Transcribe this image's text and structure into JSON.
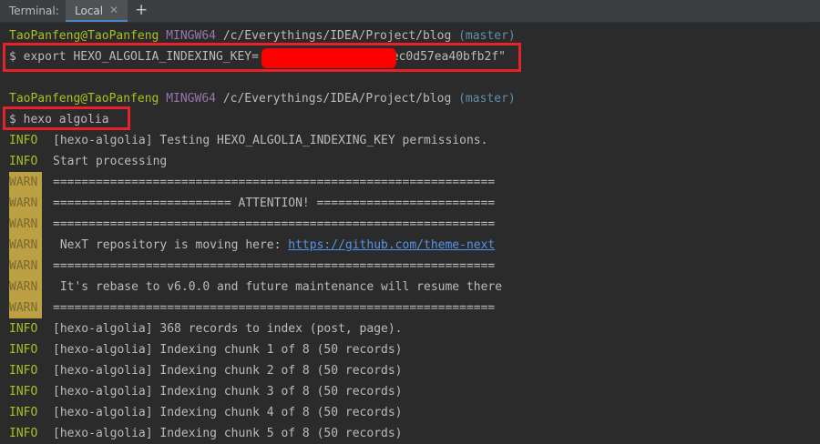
{
  "tabbar": {
    "label": "Terminal:",
    "tab": "Local",
    "close": "✕",
    "add": "+"
  },
  "prompt1": {
    "user": "TaoPanfeng@TaoPanfeng",
    "shell": "MINGW64",
    "path": "/c/Everythings/IDEA/Project/blog",
    "branch": "(master)"
  },
  "cmd1": {
    "dollar": "$",
    "text": "export HEXO_ALGOLIA_INDEXING_KEY=",
    "tail": "0ec0d57ea40bfb2f\""
  },
  "prompt2": {
    "user": "TaoPanfeng@TaoPanfeng",
    "shell": "MINGW64",
    "path": "/c/Everythings/IDEA/Project/blog",
    "branch": "(master)"
  },
  "cmd2": {
    "dollar": "$",
    "text": "hexo algolia"
  },
  "log": [
    {
      "level": "INFO",
      "text": "[hexo-algolia] Testing HEXO_ALGOLIA_INDEXING_KEY permissions."
    },
    {
      "level": "INFO",
      "text": "Start processing"
    },
    {
      "level": "WARN",
      "text": "=============================================================="
    },
    {
      "level": "WARN",
      "text": "========================= ATTENTION! ========================="
    },
    {
      "level": "WARN",
      "text": "=============================================================="
    },
    {
      "level": "WARN",
      "text": " NexT repository is moving here: ",
      "link": "https://github.com/theme-next"
    },
    {
      "level": "WARN",
      "text": "=============================================================="
    },
    {
      "level": "WARN",
      "text": " It's rebase to v6.0.0 and future maintenance will resume there"
    },
    {
      "level": "WARN",
      "text": "=============================================================="
    },
    {
      "level": "INFO",
      "text": "[hexo-algolia] 368 records to index (post, page)."
    },
    {
      "level": "INFO",
      "text": "[hexo-algolia] Indexing chunk 1 of 8 (50 records)"
    },
    {
      "level": "INFO",
      "text": "[hexo-algolia] Indexing chunk 2 of 8 (50 records)"
    },
    {
      "level": "INFO",
      "text": "[hexo-algolia] Indexing chunk 3 of 8 (50 records)"
    },
    {
      "level": "INFO",
      "text": "[hexo-algolia] Indexing chunk 4 of 8 (50 records)"
    },
    {
      "level": "INFO",
      "text": "[hexo-algolia] Indexing chunk 5 of 8 (50 records)"
    }
  ]
}
